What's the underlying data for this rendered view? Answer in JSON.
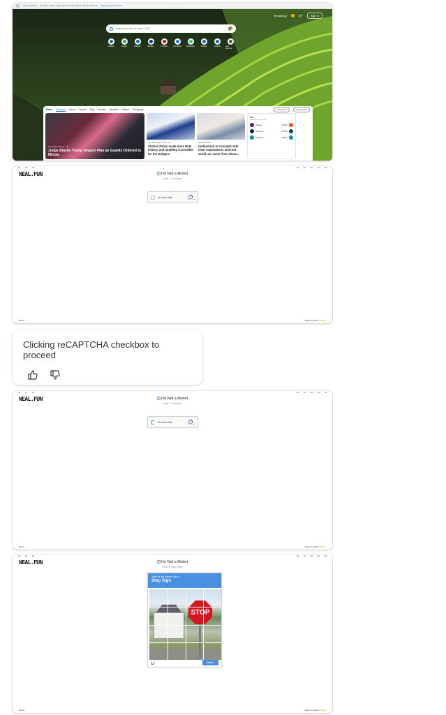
{
  "shot1": {
    "browser_bar": {
      "import_label": "Import favorites",
      "notice": "For quick access, place your favorites here on the favorites bar.",
      "manage_link": "Manage favorites now"
    },
    "header": {
      "location": "Kingsburg",
      "temperature": "63°",
      "signin": "Sign in"
    },
    "search": {
      "placeholder": "Search the web or enter a URL"
    },
    "quick_links": [
      {
        "label": "Outlook",
        "color": "#0f6cbd"
      },
      {
        "label": "Spotify",
        "color": "#1db954"
      },
      {
        "label": "Walmart",
        "color": "#0071dc"
      },
      {
        "label": "Booking",
        "color": "#003580"
      },
      {
        "label": "YouTube",
        "color": "#ff0000"
      },
      {
        "label": "Facebook",
        "color": "#1877f2"
      },
      {
        "label": "WhatsApp",
        "color": "#25d366"
      },
      {
        "label": "Outlook",
        "color": "#0f6cbd"
      },
      {
        "label": "LinkedIn",
        "color": "#0a66c2"
      },
      {
        "label": "Add shortcut",
        "color": "#555555"
      }
    ],
    "news": {
      "brand": "News",
      "tabs": [
        "Discover",
        "News",
        "Sports",
        "Play",
        "Money",
        "Weather",
        "Watch",
        "Shopping"
      ],
      "feed_layout": "Feed layout",
      "personalize": "Personalize",
      "cards": [
        {
          "source": "Associated Press · 2h",
          "title": "Judge Blocks Trump Oregon Plan as Guards Ordered to Illinois"
        },
        {
          "source": "The Washington Post · 4h",
          "title": "Shohei Ohtani made more MLB history, and anything is possible for the Dodgers"
        },
        {
          "source": "Global Notices",
          "title": "Understand AI concepts with clear explanations and real-world use cases from Glean..."
        }
      ],
      "scores": {
        "league": "NFL",
        "subtitle": "Results to your view",
        "games": [
          {
            "away": "Vikings",
            "home": "Browns",
            "status": "FINAL"
          },
          {
            "away": "Broncos",
            "home": "Eagles",
            "status": "FINAL"
          },
          {
            "away": "Dolphins",
            "home": "Panthers",
            "status": "FINAL"
          }
        ]
      }
    }
  },
  "neal": {
    "logo": "NEAL.FUN",
    "title": "I'm Not a Robot",
    "level1": "Level 1: Checkbox",
    "level2": "Level 2: Stop Signs",
    "checkbox_label": "I'm not a robot",
    "recaptcha_brand": "reCAPTCHA",
    "reset": "Reset",
    "made_by": "Made by Neal",
    "sponsor": "Sponsor"
  },
  "challenge": {
    "prompt": "Select all the squares with a",
    "target": "Stop Sign",
    "sign_text": "STOP",
    "verify": "VERIFY"
  },
  "chat": {
    "message": "Clicking reCAPTCHA checkbox to proceed"
  }
}
